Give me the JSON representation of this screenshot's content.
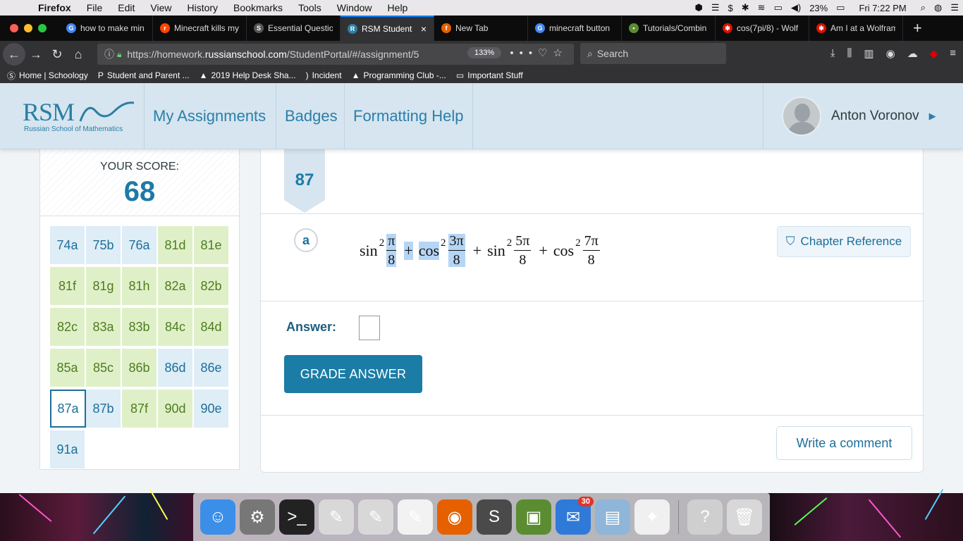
{
  "menubar": {
    "app": "Firefox",
    "items": [
      "File",
      "Edit",
      "View",
      "History",
      "Bookmarks",
      "Tools",
      "Window",
      "Help"
    ],
    "battery": "23%",
    "clock": "Fri 7:22 PM"
  },
  "tabs": [
    {
      "title": "how to make min",
      "color": "#4285f4",
      "glyph": "G"
    },
    {
      "title": "Minecraft kills my",
      "color": "#ff4500",
      "glyph": "r"
    },
    {
      "title": "Essential Questio",
      "color": "#555555",
      "glyph": "S"
    },
    {
      "title": "RSM Student",
      "color": "#2a7ea6",
      "glyph": "R",
      "active": true
    },
    {
      "title": "New Tab",
      "color": "#e66000",
      "glyph": "f"
    },
    {
      "title": "minecraft button",
      "color": "#4285f4",
      "glyph": "G"
    },
    {
      "title": "Tutorials/Combin",
      "color": "#5b8c32",
      "glyph": "▪"
    },
    {
      "title": "cos(7pi/8) - Wolf",
      "color": "#dd1100",
      "glyph": "✱"
    },
    {
      "title": "Am I at a Wolfram",
      "color": "#dd1100",
      "glyph": "✱"
    }
  ],
  "nav": {
    "url_prefix": "https://homework.",
    "url_domain": "russianschool.com",
    "url_suffix": "/StudentPortal/#/assignment/5",
    "zoom": "133%",
    "search_placeholder": "Search"
  },
  "bookmarks": [
    {
      "label": "Home | Schoology",
      "icon": "Ⓢ"
    },
    {
      "label": "Student and Parent ...",
      "icon": "P"
    },
    {
      "label": "2019 Help Desk Sha...",
      "icon": "▲"
    },
    {
      "label": "Incident",
      "icon": ")"
    },
    {
      "label": "Programming Club -...",
      "icon": "▲"
    },
    {
      "label": "Important Stuff",
      "icon": "▭"
    }
  ],
  "header": {
    "logo_text": "RSM",
    "logo_subtitle": "Russian School of Mathematics",
    "nav": [
      "My Assignments",
      "Badges",
      "Formatting Help"
    ],
    "user_name": "Anton Voronov"
  },
  "score": {
    "label": "YOUR SCORE:",
    "value": "68",
    "problems": [
      {
        "id": "74a",
        "status": "blue"
      },
      {
        "id": "75b",
        "status": "blue"
      },
      {
        "id": "76a",
        "status": "blue"
      },
      {
        "id": "81d",
        "status": "green"
      },
      {
        "id": "81e",
        "status": "green"
      },
      {
        "id": "81f",
        "status": "green"
      },
      {
        "id": "81g",
        "status": "green"
      },
      {
        "id": "81h",
        "status": "green"
      },
      {
        "id": "82a",
        "status": "green"
      },
      {
        "id": "82b",
        "status": "green"
      },
      {
        "id": "82c",
        "status": "green"
      },
      {
        "id": "83a",
        "status": "green"
      },
      {
        "id": "83b",
        "status": "green"
      },
      {
        "id": "84c",
        "status": "green"
      },
      {
        "id": "84d",
        "status": "green"
      },
      {
        "id": "85a",
        "status": "green"
      },
      {
        "id": "85c",
        "status": "green"
      },
      {
        "id": "86b",
        "status": "green"
      },
      {
        "id": "86d",
        "status": "blue"
      },
      {
        "id": "86e",
        "status": "blue"
      },
      {
        "id": "87a",
        "status": "current"
      },
      {
        "id": "87b",
        "status": "blue"
      },
      {
        "id": "87f",
        "status": "green"
      },
      {
        "id": "90d",
        "status": "green"
      },
      {
        "id": "90e",
        "status": "blue"
      },
      {
        "id": "91a",
        "status": "blue"
      }
    ]
  },
  "problem": {
    "number": "87",
    "part": "a",
    "formula": {
      "t1_fn": "sin",
      "t1_exp": "2",
      "t1_num": "π",
      "t1_den": "8",
      "t2_fn": "cos",
      "t2_exp": "2",
      "t2_num": "3π",
      "t2_den": "8",
      "t3_fn": "sin",
      "t3_exp": "2",
      "t3_num": "5π",
      "t3_den": "8",
      "t4_fn": "cos",
      "t4_exp": "2",
      "t4_num": "7π",
      "t4_den": "8",
      "plus": "+"
    },
    "chapter_reference": "Chapter Reference",
    "answer_label": "Answer:",
    "answer_value": "",
    "grade_button": "GRADE ANSWER",
    "comment_button": "Write a comment"
  },
  "dock": [
    {
      "name": "Finder",
      "color": "#3b8fe8",
      "glyph": "☺"
    },
    {
      "name": "System Preferences",
      "color": "#777777",
      "glyph": "⚙"
    },
    {
      "name": "Terminal",
      "color": "#222222",
      "glyph": ">_"
    },
    {
      "name": "Preview",
      "color": "#d8d8d8",
      "glyph": "✎"
    },
    {
      "name": "Script Editor",
      "color": "#d8d8d8",
      "glyph": "✎"
    },
    {
      "name": "TextEdit",
      "color": "#f2f2f2",
      "glyph": "✎"
    },
    {
      "name": "Firefox",
      "color": "#e66000",
      "glyph": "◉"
    },
    {
      "name": "Sublime Text",
      "color": "#4a4a4a",
      "glyph": "S"
    },
    {
      "name": "Minecraft",
      "color": "#5b8c32",
      "glyph": "▣"
    },
    {
      "name": "Airmail",
      "color": "#2f7ad8",
      "glyph": "✉",
      "badge": "30"
    },
    {
      "name": "Image Capture",
      "color": "#8fb5d8",
      "glyph": "▤"
    },
    {
      "name": "Grapher",
      "color": "#f0f0f0",
      "glyph": "✦"
    },
    {
      "name": "Help",
      "color": "#cfcfcf",
      "glyph": "?"
    },
    {
      "name": "Trash",
      "color": "#d8d8d8",
      "glyph": "🗑"
    }
  ]
}
